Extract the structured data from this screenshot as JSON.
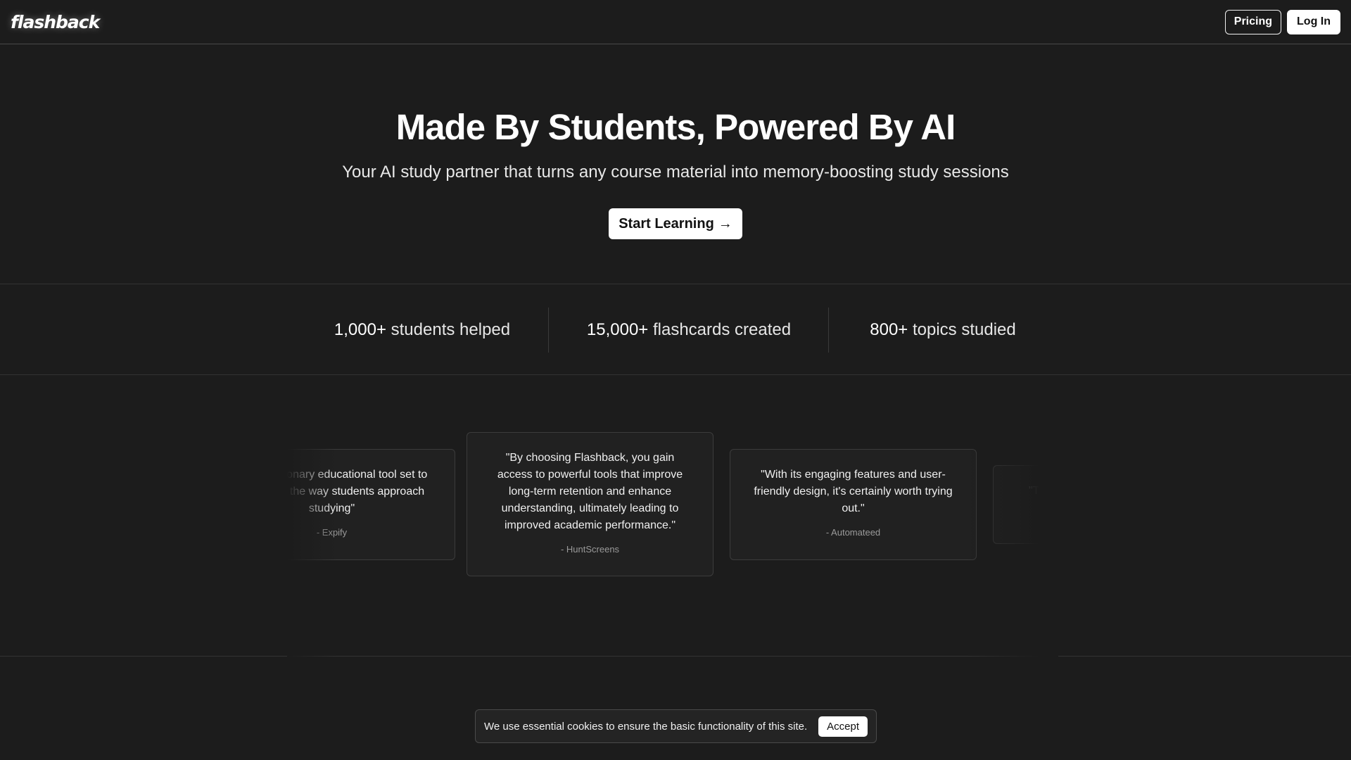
{
  "header": {
    "logo": "flashback",
    "pricing_label": "Pricing",
    "login_label": "Log In"
  },
  "hero": {
    "title": "Made By Students, Powered By AI",
    "subtitle": "Your AI study partner that turns any course material into memory-boosting study sessions",
    "cta_label": "Start Learning",
    "cta_icon": "→"
  },
  "stats": [
    {
      "number": "1,000+",
      "label": "students helped"
    },
    {
      "number": "15,000+",
      "label": "flashcards created"
    },
    {
      "number": "800+",
      "label": "topics studied"
    }
  ],
  "testimonials": [
    {
      "quote": "\"A revolutionary educational tool set to transform the way students approach studying\"",
      "author": "- Expify"
    },
    {
      "quote": "\"By choosing Flashback, you gain access to powerful tools that improve long-term retention and enhance understanding, ultimately leading to improved academic performance.\"",
      "author": "- HuntScreens"
    },
    {
      "quote": "\"With its engaging features and user-friendly design, it's certainly worth trying out.\"",
      "author": "- Automateed"
    },
    {
      "quote": "\"Turn",
      "author": ""
    }
  ],
  "cookie": {
    "message": "We use essential cookies to ensure the basic functionality of this site.",
    "accept_label": "Accept"
  }
}
